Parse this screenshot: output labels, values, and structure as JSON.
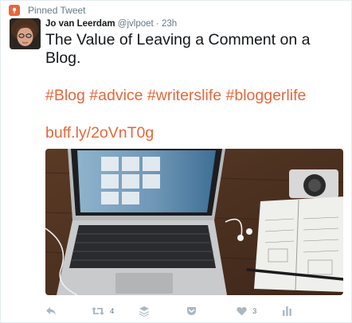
{
  "pinned_label": "Pinned Tweet",
  "author": {
    "name": "Jo van Leerdam",
    "handle": "@jvlpoet",
    "time": "23h"
  },
  "text": "The Value of Leaving a Comment on a Blog.",
  "hashtags": "#Blog #advice #writerslife #bloggerlife",
  "link": "buff.ly/2oVnT0g",
  "actions": {
    "retweets": "4",
    "likes": "3"
  },
  "colors": {
    "accent": "#e8673a",
    "muted": "#657786",
    "icon": "#aab8c2"
  },
  "icons": [
    "pin-icon",
    "reply-icon",
    "retweet-icon",
    "buffer-icon",
    "pocket-icon",
    "heart-icon",
    "analytics-icon"
  ]
}
